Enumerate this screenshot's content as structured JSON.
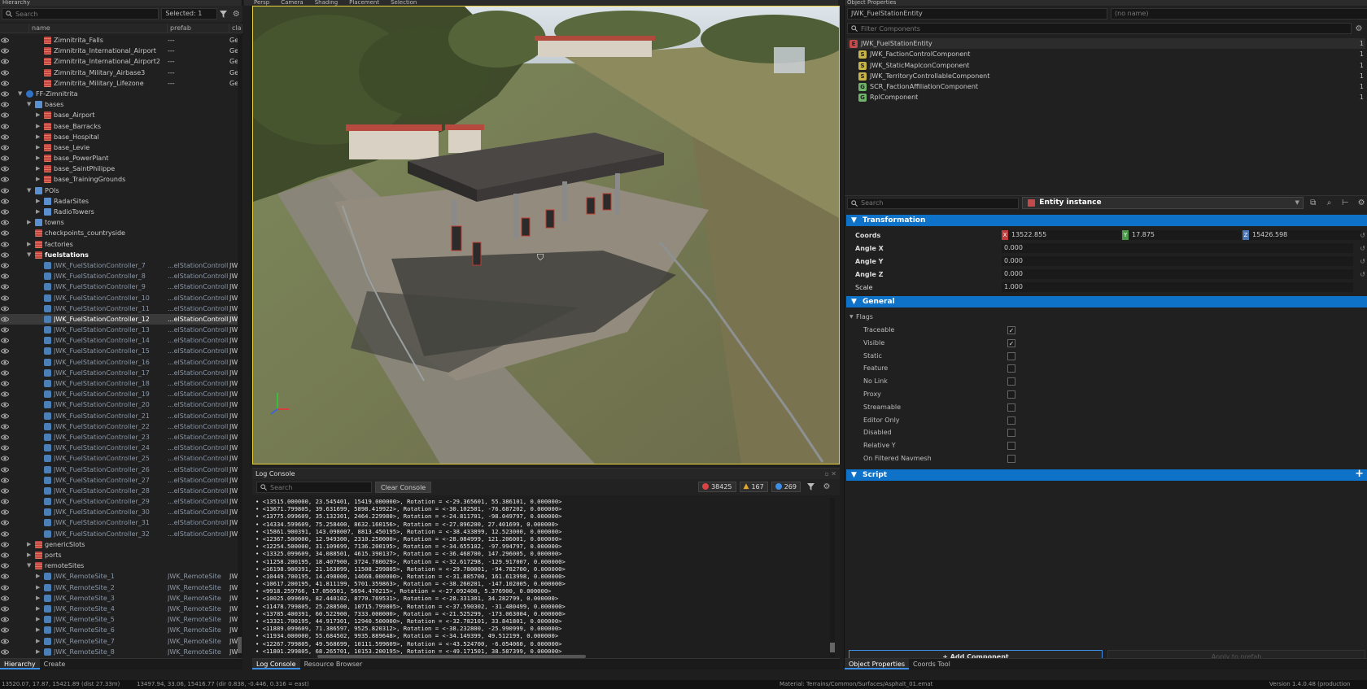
{
  "hierarchy": {
    "title": "Hierarchy",
    "search_placeholder": "Search",
    "selected_label": "Selected: 1",
    "columns": {
      "name": "name",
      "prefab": "prefab",
      "class": "cla"
    },
    "rows": [
      {
        "name": "Zimnitrita_Falls",
        "prefab": "---",
        "cls": "Ger",
        "indent": 3,
        "icon": "stack",
        "arrow": ""
      },
      {
        "name": "Zimnitrita_International_Airport",
        "prefab": "---",
        "cls": "Ger",
        "indent": 3,
        "icon": "stack",
        "arrow": ""
      },
      {
        "name": "Zimnitrita_International_Airport2",
        "prefab": "---",
        "cls": "Ger",
        "indent": 3,
        "icon": "stack",
        "arrow": ""
      },
      {
        "name": "Zimnitrita_Military_Airbase3",
        "prefab": "---",
        "cls": "Ger",
        "indent": 3,
        "icon": "stack",
        "arrow": ""
      },
      {
        "name": "Zimnitrita_Military_Lifezone",
        "prefab": "---",
        "cls": "Ger",
        "indent": 3,
        "icon": "stack",
        "arrow": ""
      },
      {
        "name": "FF-Zimnitrita",
        "prefab": "",
        "cls": "",
        "indent": 1,
        "icon": "glob",
        "arrow": "▼"
      },
      {
        "name": "bases",
        "prefab": "",
        "cls": "",
        "indent": 2,
        "icon": "folder",
        "arrow": "▼"
      },
      {
        "name": "base_Airport",
        "prefab": "",
        "cls": "",
        "indent": 3,
        "icon": "stack",
        "arrow": "▶"
      },
      {
        "name": "base_Barracks",
        "prefab": "",
        "cls": "",
        "indent": 3,
        "icon": "stack",
        "arrow": "▶"
      },
      {
        "name": "base_Hospital",
        "prefab": "",
        "cls": "",
        "indent": 3,
        "icon": "stack",
        "arrow": "▶"
      },
      {
        "name": "base_Levie",
        "prefab": "",
        "cls": "",
        "indent": 3,
        "icon": "stack",
        "arrow": "▶"
      },
      {
        "name": "base_PowerPlant",
        "prefab": "",
        "cls": "",
        "indent": 3,
        "icon": "stack",
        "arrow": "▶"
      },
      {
        "name": "base_SaintPhilippe",
        "prefab": "",
        "cls": "",
        "indent": 3,
        "icon": "stack",
        "arrow": "▶"
      },
      {
        "name": "base_TrainingGrounds",
        "prefab": "",
        "cls": "",
        "indent": 3,
        "icon": "stack",
        "arrow": "▶"
      },
      {
        "name": "POIs",
        "prefab": "",
        "cls": "",
        "indent": 2,
        "icon": "folder",
        "arrow": "▼"
      },
      {
        "name": "RadarSites",
        "prefab": "",
        "cls": "",
        "indent": 3,
        "icon": "folder",
        "arrow": "▶"
      },
      {
        "name": "RadioTowers",
        "prefab": "",
        "cls": "",
        "indent": 3,
        "icon": "folder",
        "arrow": "▶"
      },
      {
        "name": "towns",
        "prefab": "",
        "cls": "",
        "indent": 2,
        "icon": "folder",
        "arrow": "▶"
      },
      {
        "name": "checkpoints_countryside",
        "prefab": "",
        "cls": "",
        "indent": 2,
        "icon": "stack",
        "arrow": ""
      },
      {
        "name": "factories",
        "prefab": "",
        "cls": "",
        "indent": 2,
        "icon": "stack",
        "arrow": "▶"
      },
      {
        "name": "fuelstations",
        "prefab": "",
        "cls": "",
        "indent": 2,
        "icon": "stack",
        "arrow": "▼",
        "bold": true
      },
      {
        "name": "JWK_FuelStationController_7",
        "prefab": "...elStationController",
        "cls": "JWI",
        "indent": 3,
        "icon": "ent",
        "arrow": "",
        "dim": true
      },
      {
        "name": "JWK_FuelStationController_8",
        "prefab": "...elStationController",
        "cls": "JWI",
        "indent": 3,
        "icon": "ent",
        "arrow": "",
        "dim": true
      },
      {
        "name": "JWK_FuelStationController_9",
        "prefab": "...elStationController",
        "cls": "JWI",
        "indent": 3,
        "icon": "ent",
        "arrow": "",
        "dim": true
      },
      {
        "name": "JWK_FuelStationController_10",
        "prefab": "...elStationController",
        "cls": "JWI",
        "indent": 3,
        "icon": "ent",
        "arrow": "",
        "dim": true
      },
      {
        "name": "JWK_FuelStationController_11",
        "prefab": "...elStationController",
        "cls": "JWI",
        "indent": 3,
        "icon": "ent",
        "arrow": "",
        "dim": true
      },
      {
        "name": "JWK_FuelStationController_12",
        "prefab": "...elStationController",
        "cls": "JWI",
        "indent": 3,
        "icon": "ent",
        "arrow": "",
        "selected": true
      },
      {
        "name": "JWK_FuelStationController_13",
        "prefab": "...elStationController",
        "cls": "JWI",
        "indent": 3,
        "icon": "ent",
        "arrow": "",
        "dim": true
      },
      {
        "name": "JWK_FuelStationController_14",
        "prefab": "...elStationController",
        "cls": "JWI",
        "indent": 3,
        "icon": "ent",
        "arrow": "",
        "dim": true
      },
      {
        "name": "JWK_FuelStationController_15",
        "prefab": "...elStationController",
        "cls": "JWI",
        "indent": 3,
        "icon": "ent",
        "arrow": "",
        "dim": true
      },
      {
        "name": "JWK_FuelStationController_16",
        "prefab": "...elStationController",
        "cls": "JWI",
        "indent": 3,
        "icon": "ent",
        "arrow": "",
        "dim": true
      },
      {
        "name": "JWK_FuelStationController_17",
        "prefab": "...elStationController",
        "cls": "JWI",
        "indent": 3,
        "icon": "ent",
        "arrow": "",
        "dim": true
      },
      {
        "name": "JWK_FuelStationController_18",
        "prefab": "...elStationController",
        "cls": "JWI",
        "indent": 3,
        "icon": "ent",
        "arrow": "",
        "dim": true
      },
      {
        "name": "JWK_FuelStationController_19",
        "prefab": "...elStationController",
        "cls": "JWI",
        "indent": 3,
        "icon": "ent",
        "arrow": "",
        "dim": true
      },
      {
        "name": "JWK_FuelStationController_20",
        "prefab": "...elStationController",
        "cls": "JWI",
        "indent": 3,
        "icon": "ent",
        "arrow": "",
        "dim": true
      },
      {
        "name": "JWK_FuelStationController_21",
        "prefab": "...elStationController",
        "cls": "JWI",
        "indent": 3,
        "icon": "ent",
        "arrow": "",
        "dim": true
      },
      {
        "name": "JWK_FuelStationController_22",
        "prefab": "...elStationController",
        "cls": "JWI",
        "indent": 3,
        "icon": "ent",
        "arrow": "",
        "dim": true
      },
      {
        "name": "JWK_FuelStationController_23",
        "prefab": "...elStationController",
        "cls": "JWI",
        "indent": 3,
        "icon": "ent",
        "arrow": "",
        "dim": true
      },
      {
        "name": "JWK_FuelStationController_24",
        "prefab": "...elStationController",
        "cls": "JWI",
        "indent": 3,
        "icon": "ent",
        "arrow": "",
        "dim": true
      },
      {
        "name": "JWK_FuelStationController_25",
        "prefab": "...elStationController",
        "cls": "JWI",
        "indent": 3,
        "icon": "ent",
        "arrow": "",
        "dim": true
      },
      {
        "name": "JWK_FuelStationController_26",
        "prefab": "...elStationController",
        "cls": "JWI",
        "indent": 3,
        "icon": "ent",
        "arrow": "",
        "dim": true
      },
      {
        "name": "JWK_FuelStationController_27",
        "prefab": "...elStationController",
        "cls": "JWI",
        "indent": 3,
        "icon": "ent",
        "arrow": "",
        "dim": true
      },
      {
        "name": "JWK_FuelStationController_28",
        "prefab": "...elStationController",
        "cls": "JWI",
        "indent": 3,
        "icon": "ent",
        "arrow": "",
        "dim": true
      },
      {
        "name": "JWK_FuelStationController_29",
        "prefab": "...elStationController",
        "cls": "JWI",
        "indent": 3,
        "icon": "ent",
        "arrow": "",
        "dim": true
      },
      {
        "name": "JWK_FuelStationController_30",
        "prefab": "...elStationController",
        "cls": "JWI",
        "indent": 3,
        "icon": "ent",
        "arrow": "",
        "dim": true
      },
      {
        "name": "JWK_FuelStationController_31",
        "prefab": "...elStationController",
        "cls": "JWI",
        "indent": 3,
        "icon": "ent",
        "arrow": "",
        "dim": true
      },
      {
        "name": "JWK_FuelStationController_32",
        "prefab": "...elStationController",
        "cls": "JWI",
        "indent": 3,
        "icon": "ent",
        "arrow": "",
        "dim": true
      },
      {
        "name": "genericSlots",
        "prefab": "",
        "cls": "",
        "indent": 2,
        "icon": "stack",
        "arrow": "▶"
      },
      {
        "name": "ports",
        "prefab": "",
        "cls": "",
        "indent": 2,
        "icon": "stack",
        "arrow": "▶"
      },
      {
        "name": "remoteSites",
        "prefab": "",
        "cls": "",
        "indent": 2,
        "icon": "stack",
        "arrow": "▼"
      },
      {
        "name": "JWK_RemoteSite_1",
        "prefab": "JWK_RemoteSite",
        "cls": "JWI",
        "indent": 3,
        "icon": "ent",
        "arrow": "▶",
        "dim": true
      },
      {
        "name": "JWK_RemoteSite_2",
        "prefab": "JWK_RemoteSite",
        "cls": "JWI",
        "indent": 3,
        "icon": "ent",
        "arrow": "▶",
        "dim": true
      },
      {
        "name": "JWK_RemoteSite_3",
        "prefab": "JWK_RemoteSite",
        "cls": "JWI",
        "indent": 3,
        "icon": "ent",
        "arrow": "▶",
        "dim": true
      },
      {
        "name": "JWK_RemoteSite_4",
        "prefab": "JWK_RemoteSite",
        "cls": "JWI",
        "indent": 3,
        "icon": "ent",
        "arrow": "▶",
        "dim": true
      },
      {
        "name": "JWK_RemoteSite_5",
        "prefab": "JWK_RemoteSite",
        "cls": "JWI",
        "indent": 3,
        "icon": "ent",
        "arrow": "▶",
        "dim": true
      },
      {
        "name": "JWK_RemoteSite_6",
        "prefab": "JWK_RemoteSite",
        "cls": "JWI",
        "indent": 3,
        "icon": "ent",
        "arrow": "▶",
        "dim": true
      },
      {
        "name": "JWK_RemoteSite_7",
        "prefab": "JWK_RemoteSite",
        "cls": "JWI",
        "indent": 3,
        "icon": "ent",
        "arrow": "▶",
        "dim": true
      },
      {
        "name": "JWK_RemoteSite_8",
        "prefab": "JWK_RemoteSite",
        "cls": "JWI",
        "indent": 3,
        "icon": "ent",
        "arrow": "▶",
        "dim": true
      }
    ],
    "bottom_tabs": [
      "Hierarchy",
      "Create"
    ]
  },
  "viewport": {
    "menus": [
      "Persp",
      "Camera",
      "Shading",
      "Placement",
      "Selection"
    ]
  },
  "log": {
    "title": "Log Console",
    "search_placeholder": "Search",
    "clear_label": "Clear Console",
    "error_count": "38425",
    "warning_count": "167",
    "info_count": "269",
    "lines": [
      "• <13515.000000, 23.545401, 15419.000000>, Rotation = <-29.365601, 55.386101, 0.000000>",
      "• <13671.799805, 39.631699, 5898.419922>, Rotation = <-30.102501, -76.687202, 0.000000>",
      "• <13775.099609, 35.132301, 2464.229980>, Rotation = <-24.811701, -98.049797, 0.000000>",
      "• <14334.599609, 75.258400, 8632.160156>, Rotation = <-27.896200, 27.401699, 0.000000>",
      "• <15861.900391, 143.098007, 8813.450195>, Rotation = <-38.433899, 12.523000, 0.000000>",
      "• <12367.500000, 12.949300, 2310.250000>, Rotation = <-28.084999, 121.206001, 0.000000>",
      "• <12254.500000, 31.109699, 7136.200195>, Rotation = <-34.655102, -97.994797, 0.000000>",
      "• <13325.099609, 34.088501, 4615.390137>, Rotation = <-36.468700, 147.296005, 0.000000>",
      "• <11258.200195, 18.407900, 3724.780029>, Rotation = <-32.617298, -129.917007, 0.000000>",
      "• <16198.900391, 21.163099, 11508.299805>, Rotation = <-29.780001, -94.782700, 0.000000>",
      "• <10449.700195, 14.498000, 14668.000000>, Rotation = <-31.885700, 161.613998, 0.000000>",
      "• <10617.200195, 41.811199, 5701.359863>, Rotation = <-38.260201, -147.102005, 0.000000>",
      "• <9918.259766, 17.050501, 5694.470215>, Rotation = <-27.092400, 5.376900, 0.000000>",
      "• <10025.099609, 82.440102, 8770.769531>, Rotation = <-28.331301, 34.282799, 0.000000>",
      "• <11478.799805, 25.288500, 10715.799805>, Rotation = <-37.590302, -31.480499, 0.000000>",
      "• <13785.400391, 60.522900, 7333.000000>, Rotation = <-21.525299, -173.063004, 0.000000>",
      "• <13321.700195, 44.917301, 12940.500000>, Rotation = <-32.782101, 33.841801, 0.000000>",
      "• <11889.099609, 71.386597, 9525.820312>, Rotation = <-38.232800, -25.990999, 0.000000>",
      "• <11934.000000, 55.684502, 9935.889648>, Rotation = <-34.149399, 49.512199, 0.000000>",
      "• <12267.799805, 49.568699, 10111.599609>, Rotation = <-43.524700, -6.054060, 0.000000>",
      "• <11801.299805, 68.265701, 10153.200195>, Rotation = <-49.171501, 38.587399, 0.000000>"
    ],
    "bottom_tabs": [
      "Log Console",
      "Resource Browser"
    ]
  },
  "props": {
    "title": "Object Properties",
    "entity_name": "JWK_FuelStationEntity",
    "name_field": "(no name)",
    "filter_placeholder": "Filter Components",
    "components": [
      {
        "name": "JWK_FuelStationEntity",
        "num": "1",
        "icon": "E",
        "color": "#c44b4b",
        "root": true
      },
      {
        "name": "JWK_FactionControlComponent",
        "num": "1",
        "icon": "S",
        "color": "#c7b447"
      },
      {
        "name": "JWK_StaticMapIconComponent",
        "num": "1",
        "icon": "S",
        "color": "#c7b447"
      },
      {
        "name": "JWK_TerritoryControllableComponent",
        "num": "1",
        "icon": "S",
        "color": "#c7b447"
      },
      {
        "name": "SCR_FactionAffiliationComponent",
        "num": "1",
        "icon": "G",
        "color": "#6fb46a"
      },
      {
        "name": "RplComponent",
        "num": "1",
        "icon": "G",
        "color": "#6fb46a"
      }
    ],
    "inspector_search_placeholder": "Search",
    "entity_instance_label": "Entity instance",
    "transformation": {
      "title": "Transformation",
      "coords_label": "Coords",
      "x": "13522.855",
      "y": "17.875",
      "z": "15426.598",
      "angle_x_label": "Angle X",
      "angle_x": "0.000",
      "angle_y_label": "Angle Y",
      "angle_y": "0.000",
      "angle_z_label": "Angle Z",
      "angle_z": "0.000",
      "scale_label": "Scale",
      "scale": "1.000"
    },
    "general": {
      "title": "General",
      "flags_label": "Flags",
      "flags": [
        {
          "label": "Traceable",
          "checked": true
        },
        {
          "label": "Visible",
          "checked": true
        },
        {
          "label": "Static",
          "checked": false
        },
        {
          "label": "Feature",
          "checked": false
        },
        {
          "label": "No Link",
          "checked": false
        },
        {
          "label": "Proxy",
          "checked": false
        },
        {
          "label": "Streamable",
          "checked": false
        },
        {
          "label": "Editor Only",
          "checked": false
        },
        {
          "label": "Disabled",
          "checked": false
        },
        {
          "label": "Relative Y",
          "checked": false
        },
        {
          "label": "On Filtered Navmesh",
          "checked": false
        }
      ]
    },
    "script_title": "Script",
    "add_component": "+ Add Component",
    "apply_prefab": "Apply to prefab",
    "bottom_tabs": [
      "Object Properties",
      "Coords Tool"
    ]
  },
  "status": {
    "left": "13520.07, 17.87, 15421.89 (dist 27.33m)",
    "mid": "13497.94, 33.06, 15416.77 (dir 0.838, -0.446, 0.316 = east)",
    "material": "Material: Terrains/Common/Surfaces/Asphalt_01.emat",
    "version": "Version 1.4.0.48 (production"
  },
  "colors": {
    "accent": "#0f72c9",
    "selection_outline": "#e8d13a",
    "error": "#d94343",
    "warning": "#e0a92a",
    "info": "#3d8ee6"
  }
}
